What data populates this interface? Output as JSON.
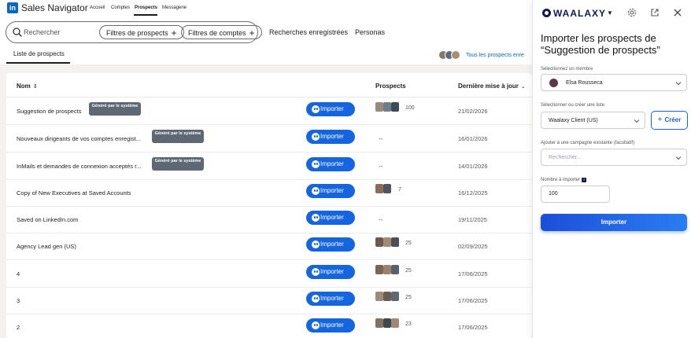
{
  "topbar": {
    "brand": "Sales Navigator",
    "nav": [
      "Accueil",
      "Comptes",
      "Prospects",
      "Messagerie"
    ],
    "active_nav": "Prospects"
  },
  "searchbar": {
    "placeholder": "Rechercher",
    "filter_prospects": "Filtres de prospects",
    "filter_accounts": "Filtres de comptes",
    "saved_searches": "Recherches enregistrées",
    "personas": "Personas"
  },
  "tabs": {
    "active": "Liste de prospects",
    "team_link": "Tous les prospects enre"
  },
  "table": {
    "headers": {
      "name": "Nom",
      "prospects": "Prospects",
      "updated": "Dernière mise à jour"
    },
    "import_label": "Importer",
    "rows": [
      {
        "name": "Suggestion de prospects",
        "badge": "Généré par le système",
        "count": "100",
        "date": "21/02/2026"
      },
      {
        "name": "Nouveaux dirigeants de vos comptes enregist...",
        "badge": "Généré par le système",
        "count": "--",
        "date": "16/01/2026"
      },
      {
        "name": "InMails et demandes de connexion acceptés r...",
        "badge": "Généré par le système",
        "count": "--",
        "date": "14/01/2026"
      },
      {
        "name": "Copy of New Executives at Saved Accounts",
        "badge": "",
        "count": "7",
        "date": "16/12/2025"
      },
      {
        "name": "Saved on LinkedIn.com",
        "badge": "",
        "count": "--",
        "date": "19/11/2025"
      },
      {
        "name": "Agency Lead gen (US)",
        "badge": "",
        "count": "25",
        "date": "02/09/2025"
      },
      {
        "name": "4",
        "badge": "",
        "count": "25",
        "date": "17/06/2025"
      },
      {
        "name": "3",
        "badge": "",
        "count": "25",
        "date": "17/06/2025"
      },
      {
        "name": "2",
        "badge": "",
        "count": "23",
        "date": "17/06/2025"
      }
    ]
  },
  "waalaxy": {
    "brand": "WAALAXY",
    "title": "Importer les prospects de “Suggestion de prospects”",
    "member_label": "Sélectionnez un membre",
    "member_value": "Elsa Rousseca",
    "list_label": "Sélectionner ou créer une liste",
    "list_value": "Waalaxy Client (US)",
    "create_label": "Créer",
    "campaign_label": "Ajouter à une campagne existante (facultatif)",
    "campaign_placeholder": "Rechercher...",
    "number_label": "Nombre à importer",
    "number_value": "100",
    "import_button": "Importer"
  },
  "colors": {
    "linkedin_blue": "#0a66c2",
    "import_button": "#1565e0",
    "badge_bg": "#5d6874",
    "waalaxy_navy": "#0f1b4c"
  },
  "icons": [
    "linkedin-logo",
    "search-icon",
    "sort-icon",
    "ghost-icon",
    "gear-icon",
    "open-external-icon",
    "close-icon",
    "chevron-down-icon",
    "plus-icon",
    "info-icon"
  ]
}
